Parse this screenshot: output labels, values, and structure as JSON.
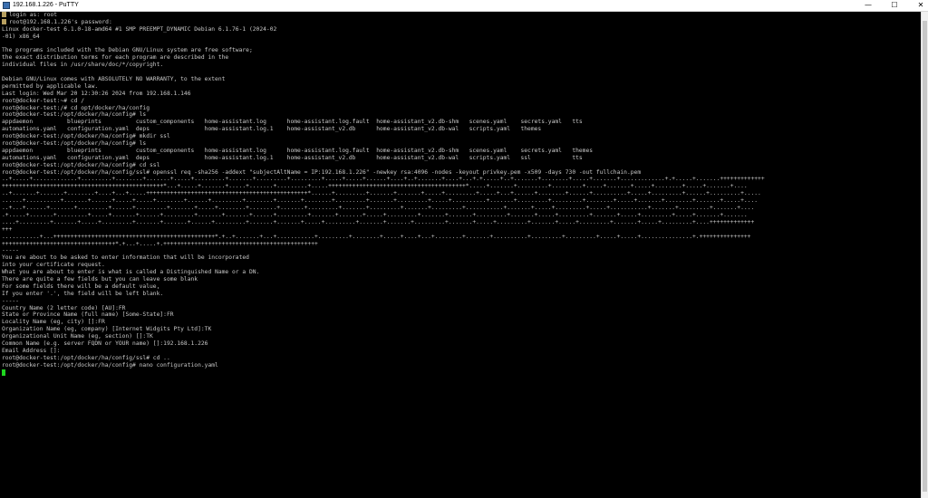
{
  "window": {
    "title": "192.168.1.226 - PuTTY",
    "controls": {
      "minimize": "—",
      "maximize": "☐",
      "close": "✕"
    }
  },
  "terminal": {
    "lines": [
      "login as: root",
      "root@192.168.1.226's password:",
      "Linux docker-test 6.1.0-18-amd64 #1 SMP PREEMPT_DYNAMIC Debian 6.1.76-1 (2024-02",
      "-01) x86_64",
      "",
      "The programs included with the Debian GNU/Linux system are free software;",
      "the exact distribution terms for each program are described in the",
      "individual files in /usr/share/doc/*/copyright.",
      "",
      "Debian GNU/Linux comes with ABSOLUTELY NO WARRANTY, to the extent",
      "permitted by applicable law.",
      "Last login: Wed Mar 20 12:30:26 2024 from 192.168.1.146",
      "root@docker-test:~# cd /",
      "root@docker-test:/# cd opt/docker/ha/config",
      "root@docker-test:/opt/docker/ha/config# ls",
      "appdaemon          blueprints          custom_components   home-assistant.log      home-assistant.log.fault  home-assistant_v2.db-shm   scenes.yaml    secrets.yaml   tts",
      "automations.yaml   configuration.yaml  deps                home-assistant.log.1    home-assistant_v2.db      home-assistant_v2.db-wal   scripts.yaml   themes",
      "root@docker-test:/opt/docker/ha/config# mkdir ssl",
      "root@docker-test:/opt/docker/ha/config# ls",
      "appdaemon          blueprints          custom_components   home-assistant.log      home-assistant.log.fault  home-assistant_v2.db-shm   scenes.yaml    secrets.yaml   themes",
      "automations.yaml   configuration.yaml  deps                home-assistant.log.1    home-assistant_v2.db      home-assistant_v2.db-wal   scripts.yaml   ssl            tts",
      "root@docker-test:/opt/docker/ha/config# cd ssl",
      "root@docker-test:/opt/docker/ha/config/ssl# openssl req -sha256 -addext \"subjectAltName = IP:192.168.1.226\" -newkey rsa:4096 -nodes -keyout privkey.pem -x509 -days 730 -out fullchain.pem",
      "..+.....+.............+.........+........+.......+.....+.........+.......+.........+.........+.....+.....+......+....+..+.......+....+...+.+.....+..+.......+........+.....+.......+.............+.+.....+.......+++++++++++++",
      "+++++++++++++++++++++++++++++++++++++++++++++++*...+.....+.......+.....+.......+.........+.....++++++++++++++++++++++++++++++++++++++++*.....+.......+.........+.........+.....+.......+.....+........+.....+.......+....",
      "..+.......+.......+........+....+...+.....+++++++++++++++++++++++++++++++++++++++++++++++*......+.........+.......+.......+.....+.........+.....+...+......+........+......+..........+.....+.........+......+.........+.....",
      "......+..........+.......+......+.....+.....+........+......+.........+........+.......+........+.........+.......+.........+.....+..........+.......+.........+.........+........+.....+.......+........+.......+.....+....",
      "..+...+......+.......+.........+......+.........+.......+.....+........+........+.......+.........+.......+.........+.......+.........+...........+.......+.....+.........+.....+...........+.......+.........+.......+....",
      ".+.....+.......+.........+.....+.......+......+.........+.......+.......+......+.........+.......+.......+.....+.........+.......+.......+.........+.......+.....+.........+.......+.....+.........+.....+.......+.......",
      "....+.........+.......+.....+.........+.......+.......+......+.........+.......+.......+.....+.........+.......+.......+.........+.......+.....+.........+.......+.....+.........+.......+.....+.........+....+++++++++++++",
      "+++",
      "...........+...+++++++++++++++++++++++++++++++++++++++++++++++*.+..+.......+...+...........+.........+........+.....+....+...+........+.......+..........+.........+.........+.....+.....+...............+.+++++++++++++++",
      "+++++++++++++++++++++++++++++++++*.+...+.....+.+++++++++++++++++++++++++++++++++++++++++++++",
      "-----",
      "You are about to be asked to enter information that will be incorporated",
      "into your certificate request.",
      "What you are about to enter is what is called a Distinguished Name or a DN.",
      "There are quite a few fields but you can leave some blank",
      "For some fields there will be a default value,",
      "If you enter '.', the field will be left blank.",
      "-----",
      "Country Name (2 letter code) [AU]:FR",
      "State or Province Name (full name) [Some-State]:FR",
      "Locality Name (eg, city) []:FR",
      "Organization Name (eg, company) [Internet Widgits Pty Ltd]:TK",
      "Organizational Unit Name (eg, section) []:TK",
      "Common Name (e.g. server FQDN or YOUR name) []:192.168.1.226",
      "Email Address []:",
      "root@docker-test:/opt/docker/ha/config/ssl# cd ..",
      "root@docker-test:/opt/docker/ha/config# nano configuration.yaml"
    ]
  },
  "colors": {
    "terminal_bg": "#000000",
    "terminal_fg": "#c8c8c8",
    "cursor": "#1ed51e"
  }
}
